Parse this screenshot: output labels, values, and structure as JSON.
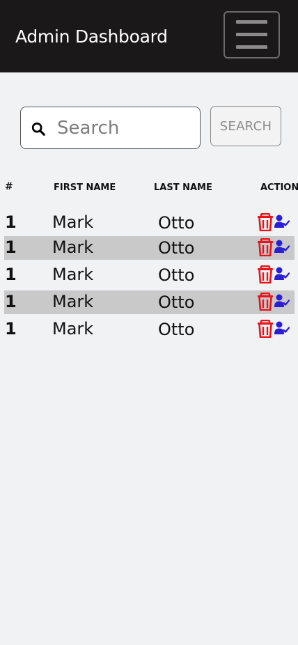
{
  "header": {
    "title": "Admin Dashboard",
    "menu_icon": "hamburger-menu-icon"
  },
  "search": {
    "placeholder": "Search",
    "value": "",
    "button_label": "SEARCH",
    "icon": "search-icon"
  },
  "table": {
    "columns": [
      "#",
      "FIRST NAME",
      "LAST NAME",
      "ACTION"
    ],
    "rows": [
      {
        "num": "1",
        "first": "Mark",
        "last": "Otto"
      },
      {
        "num": "1",
        "first": "Mark",
        "last": "Otto"
      },
      {
        "num": "1",
        "first": "Mark",
        "last": "Otto"
      },
      {
        "num": "1",
        "first": "Mark",
        "last": "Otto"
      },
      {
        "num": "1",
        "first": "Mark",
        "last": "Otto"
      }
    ],
    "action_icons": [
      "trash-icon",
      "user-check-icon"
    ]
  },
  "colors": {
    "topbar": "#1a1818",
    "delete": "#e8141c",
    "user_check": "#2a1fd6",
    "row_shade": "#cac9ca"
  }
}
